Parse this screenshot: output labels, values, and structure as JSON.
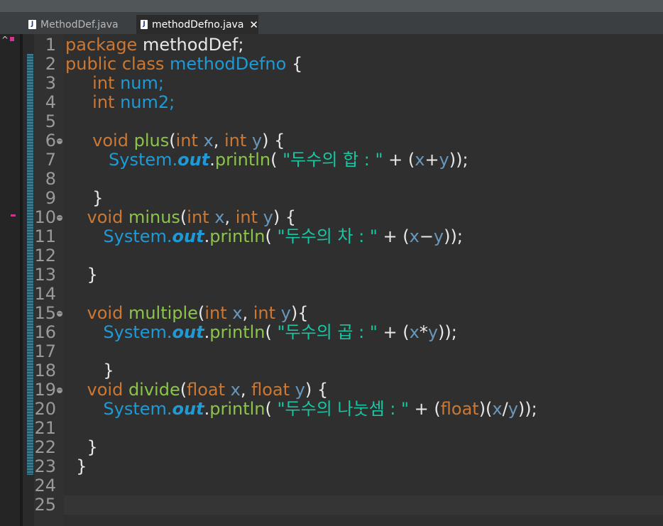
{
  "tabs": [
    {
      "label": "MethodDef.java",
      "active": false,
      "icon": "java-file-icon"
    },
    {
      "label": "methodDefno.java",
      "active": true,
      "icon": "java-file-icon",
      "close": "✕"
    }
  ],
  "colors": {
    "keyword": "#cc7832",
    "class": "#1e9ad6",
    "method": "#8cc44b",
    "string": "#17c6a3",
    "variable": "#6897bb",
    "text": "#d9e8f7",
    "line_number": "#9a9a9a",
    "background": "#2f2f2f",
    "marker": "#d92f92"
  },
  "editor": {
    "lines": [
      {
        "n": "1",
        "fold": false,
        "tokens": [
          {
            "t": "package",
            "k": "k"
          },
          {
            "t": " methodDef;",
            "k": "p"
          }
        ]
      },
      {
        "n": "2",
        "fold": false,
        "tokens": [
          {
            "t": "public class ",
            "k": "k"
          },
          {
            "t": "methodDefno",
            "k": "c"
          },
          {
            "t": " {",
            "k": "p"
          }
        ]
      },
      {
        "n": "3",
        "fold": false,
        "tokens": [
          {
            "t": "     ",
            "k": "p"
          },
          {
            "t": "int",
            "k": "k"
          },
          {
            "t": " num;",
            "k": "c"
          }
        ]
      },
      {
        "n": "4",
        "fold": false,
        "tokens": [
          {
            "t": "     ",
            "k": "p"
          },
          {
            "t": "int",
            "k": "k"
          },
          {
            "t": " num2;",
            "k": "c"
          }
        ]
      },
      {
        "n": "5",
        "fold": false,
        "tokens": []
      },
      {
        "n": "6",
        "fold": true,
        "tokens": [
          {
            "t": "     ",
            "k": "p"
          },
          {
            "t": "void ",
            "k": "k"
          },
          {
            "t": "plus",
            "k": "m"
          },
          {
            "t": "(",
            "k": "p"
          },
          {
            "t": "int ",
            "k": "k"
          },
          {
            "t": "x",
            "k": "v"
          },
          {
            "t": ", ",
            "k": "p"
          },
          {
            "t": "int ",
            "k": "k"
          },
          {
            "t": "y",
            "k": "v"
          },
          {
            "t": ") {",
            "k": "p"
          }
        ]
      },
      {
        "n": "7",
        "fold": false,
        "tokens": [
          {
            "t": "        ",
            "k": "p"
          },
          {
            "t": "System.",
            "k": "c"
          },
          {
            "t": "out",
            "k": "o"
          },
          {
            "t": ".",
            "k": "p"
          },
          {
            "t": "println",
            "k": "m"
          },
          {
            "t": "( ",
            "k": "p"
          },
          {
            "t": "\"두수의 합 : \"",
            "k": "s"
          },
          {
            "t": " + (",
            "k": "p"
          },
          {
            "t": "x",
            "k": "v"
          },
          {
            "t": "+",
            "k": "p"
          },
          {
            "t": "y",
            "k": "v"
          },
          {
            "t": "));",
            "k": "p"
          }
        ]
      },
      {
        "n": "8",
        "fold": false,
        "tokens": []
      },
      {
        "n": "9",
        "fold": false,
        "tokens": [
          {
            "t": "     }",
            "k": "p"
          }
        ]
      },
      {
        "n": "10",
        "fold": true,
        "tokens": [
          {
            "t": "    ",
            "k": "p"
          },
          {
            "t": "void ",
            "k": "k"
          },
          {
            "t": "minus",
            "k": "m"
          },
          {
            "t": "(",
            "k": "p"
          },
          {
            "t": "int ",
            "k": "k"
          },
          {
            "t": "x",
            "k": "v"
          },
          {
            "t": ", ",
            "k": "p"
          },
          {
            "t": "int ",
            "k": "k"
          },
          {
            "t": "y",
            "k": "v"
          },
          {
            "t": ") {",
            "k": "p"
          }
        ]
      },
      {
        "n": "11",
        "fold": false,
        "tokens": [
          {
            "t": "       ",
            "k": "p"
          },
          {
            "t": "System.",
            "k": "c"
          },
          {
            "t": "out",
            "k": "o"
          },
          {
            "t": ".",
            "k": "p"
          },
          {
            "t": "println",
            "k": "m"
          },
          {
            "t": "( ",
            "k": "p"
          },
          {
            "t": "\"두수의 차 : \"",
            "k": "s"
          },
          {
            "t": " + (",
            "k": "p"
          },
          {
            "t": "x",
            "k": "v"
          },
          {
            "t": "−",
            "k": "p"
          },
          {
            "t": "y",
            "k": "v"
          },
          {
            "t": "));",
            "k": "p"
          }
        ]
      },
      {
        "n": "12",
        "fold": false,
        "tokens": []
      },
      {
        "n": "13",
        "fold": false,
        "tokens": [
          {
            "t": "    }",
            "k": "p"
          }
        ]
      },
      {
        "n": "14",
        "fold": false,
        "tokens": []
      },
      {
        "n": "15",
        "fold": true,
        "tokens": [
          {
            "t": "    ",
            "k": "p"
          },
          {
            "t": "void ",
            "k": "k"
          },
          {
            "t": "multiple",
            "k": "m"
          },
          {
            "t": "(",
            "k": "p"
          },
          {
            "t": "int ",
            "k": "k"
          },
          {
            "t": "x",
            "k": "v"
          },
          {
            "t": ", ",
            "k": "p"
          },
          {
            "t": "int ",
            "k": "k"
          },
          {
            "t": "y",
            "k": "v"
          },
          {
            "t": "){",
            "k": "p"
          }
        ]
      },
      {
        "n": "16",
        "fold": false,
        "tokens": [
          {
            "t": "       ",
            "k": "p"
          },
          {
            "t": "System.",
            "k": "c"
          },
          {
            "t": "out",
            "k": "o"
          },
          {
            "t": ".",
            "k": "p"
          },
          {
            "t": "println",
            "k": "m"
          },
          {
            "t": "( ",
            "k": "p"
          },
          {
            "t": "\"두수의 곱 : \"",
            "k": "s"
          },
          {
            "t": " + (",
            "k": "p"
          },
          {
            "t": "x",
            "k": "v"
          },
          {
            "t": "*",
            "k": "p"
          },
          {
            "t": "y",
            "k": "v"
          },
          {
            "t": "));",
            "k": "p"
          }
        ]
      },
      {
        "n": "17",
        "fold": false,
        "tokens": []
      },
      {
        "n": "18",
        "fold": false,
        "tokens": [
          {
            "t": "       }",
            "k": "p"
          }
        ]
      },
      {
        "n": "19",
        "fold": true,
        "tokens": [
          {
            "t": "    ",
            "k": "p"
          },
          {
            "t": "void ",
            "k": "k"
          },
          {
            "t": "divide",
            "k": "m"
          },
          {
            "t": "(",
            "k": "p"
          },
          {
            "t": "float ",
            "k": "k"
          },
          {
            "t": "x",
            "k": "v"
          },
          {
            "t": ", ",
            "k": "p"
          },
          {
            "t": "float ",
            "k": "k"
          },
          {
            "t": "y",
            "k": "v"
          },
          {
            "t": ") {",
            "k": "p"
          }
        ]
      },
      {
        "n": "20",
        "fold": false,
        "tokens": [
          {
            "t": "       ",
            "k": "p"
          },
          {
            "t": "System.",
            "k": "c"
          },
          {
            "t": "out",
            "k": "o"
          },
          {
            "t": ".",
            "k": "p"
          },
          {
            "t": "println",
            "k": "m"
          },
          {
            "t": "( ",
            "k": "p"
          },
          {
            "t": "\"두수의 나눗셈 : \"",
            "k": "s"
          },
          {
            "t": " + (",
            "k": "p"
          },
          {
            "t": "float",
            "k": "k"
          },
          {
            "t": ")(",
            "k": "p"
          },
          {
            "t": "x",
            "k": "v"
          },
          {
            "t": "/",
            "k": "p"
          },
          {
            "t": "y",
            "k": "v"
          },
          {
            "t": "));",
            "k": "p"
          }
        ]
      },
      {
        "n": "21",
        "fold": false,
        "tokens": []
      },
      {
        "n": "22",
        "fold": false,
        "tokens": [
          {
            "t": "    }",
            "k": "p"
          }
        ]
      },
      {
        "n": "23",
        "fold": false,
        "tokens": [
          {
            "t": "  }",
            "k": "p"
          }
        ]
      },
      {
        "n": "24",
        "fold": false,
        "tokens": []
      },
      {
        "n": "25",
        "fold": false,
        "tokens": []
      }
    ],
    "current_line": "25"
  }
}
